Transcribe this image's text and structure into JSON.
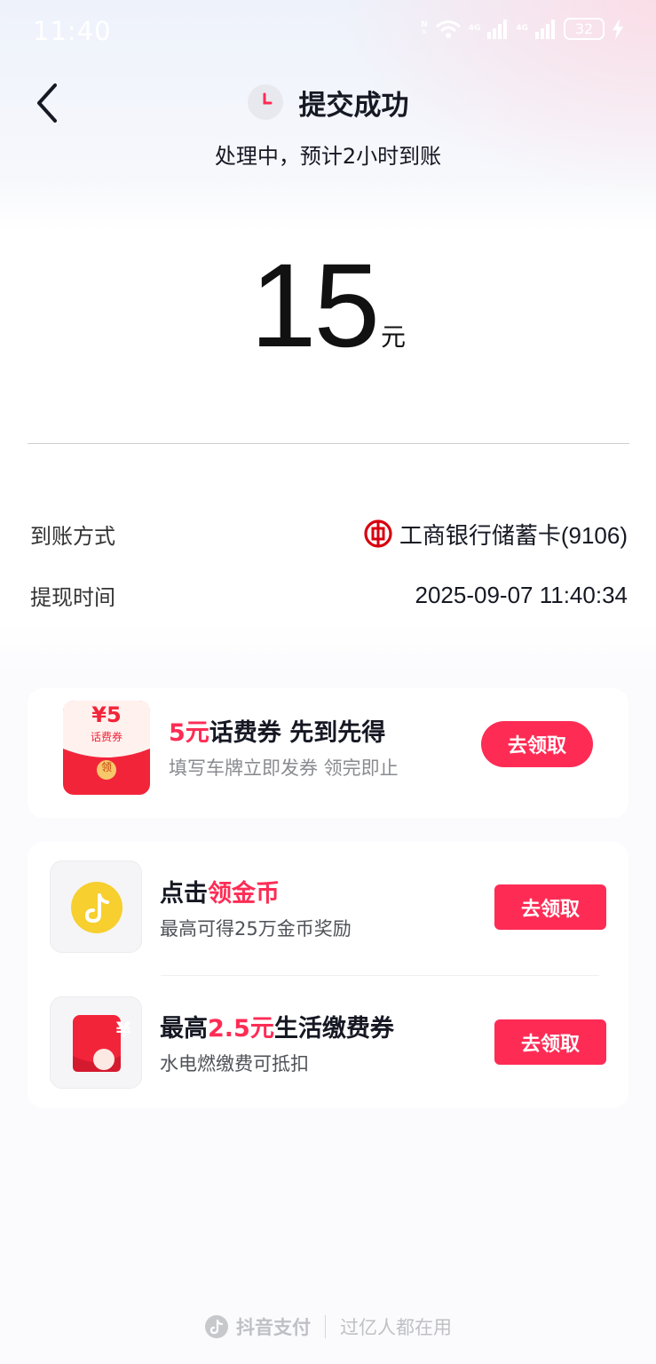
{
  "status_bar": {
    "time": "11:40",
    "net1": "4G",
    "net2": "4G",
    "battery": "32"
  },
  "header": {
    "title": "提交成功",
    "subtitle": "处理中，预计2小时到账"
  },
  "amount": {
    "value": "15",
    "unit": "元"
  },
  "details": {
    "method_label": "到账方式",
    "method_value": "工商银行储蓄卡(9106)",
    "time_label": "提现时间",
    "time_value": "2025-09-07 11:40:34"
  },
  "promo1": {
    "badge_amount": "¥5",
    "badge_label": "话费券",
    "badge_seal": "领",
    "title_red": "5元",
    "title_rest": "话费券 先到先得",
    "subtitle": "填写车牌立即发券 领完即止",
    "button": "去领取"
  },
  "promo2": {
    "title_black": "点击",
    "title_red": "领金币",
    "subtitle": "最高可得25万金币奖励",
    "button": "去领取"
  },
  "promo3": {
    "title_black1": "最高",
    "title_red": "2.5元",
    "title_black2": "生活缴费券",
    "subtitle": "水电燃缴费可抵扣",
    "icon_symbol": "¥",
    "button": "去领取"
  },
  "footer": {
    "brand": "抖音支付",
    "slogan": "过亿人都在用"
  },
  "colors": {
    "accent": "#fe2c55",
    "coin": "#f7cf2e",
    "bank_red": "#d7000f"
  }
}
